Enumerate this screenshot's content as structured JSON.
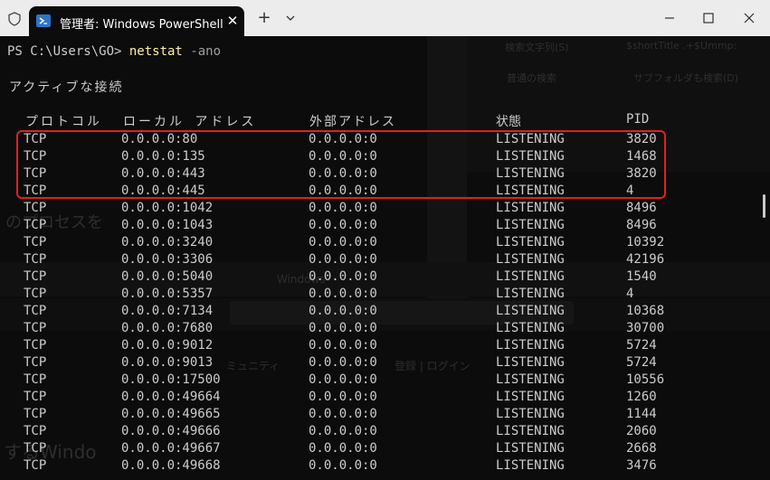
{
  "window": {
    "tab_title": "管理者: Windows PowerShell",
    "colors": {
      "titlebar": "#ececec",
      "terminal_bg": "#0c0c0c",
      "text": "#cccccc",
      "command": "#f9f1a5",
      "highlight": "#e02020"
    }
  },
  "terminal": {
    "prompt": "PS C:\\Users\\GO> ",
    "command": "netstat",
    "argument": " -ano",
    "heading": "アクティブな接続",
    "columns": [
      "プロトコル",
      "ローカル アドレス",
      "外部アドレス",
      "状態",
      "PID"
    ],
    "rows": [
      [
        "TCP",
        "0.0.0.0:80",
        "0.0.0.0:0",
        "LISTENING",
        "3820"
      ],
      [
        "TCP",
        "0.0.0.0:135",
        "0.0.0.0:0",
        "LISTENING",
        "1468"
      ],
      [
        "TCP",
        "0.0.0.0:443",
        "0.0.0.0:0",
        "LISTENING",
        "3820"
      ],
      [
        "TCP",
        "0.0.0.0:445",
        "0.0.0.0:0",
        "LISTENING",
        "4"
      ],
      [
        "TCP",
        "0.0.0.0:1042",
        "0.0.0.0:0",
        "LISTENING",
        "8496"
      ],
      [
        "TCP",
        "0.0.0.0:1043",
        "0.0.0.0:0",
        "LISTENING",
        "8496"
      ],
      [
        "TCP",
        "0.0.0.0:3240",
        "0.0.0.0:0",
        "LISTENING",
        "10392"
      ],
      [
        "TCP",
        "0.0.0.0:3306",
        "0.0.0.0:0",
        "LISTENING",
        "42196"
      ],
      [
        "TCP",
        "0.0.0.0:5040",
        "0.0.0.0:0",
        "LISTENING",
        "1540"
      ],
      [
        "TCP",
        "0.0.0.0:5357",
        "0.0.0.0:0",
        "LISTENING",
        "4"
      ],
      [
        "TCP",
        "0.0.0.0:7134",
        "0.0.0.0:0",
        "LISTENING",
        "10368"
      ],
      [
        "TCP",
        "0.0.0.0:7680",
        "0.0.0.0:0",
        "LISTENING",
        "30700"
      ],
      [
        "TCP",
        "0.0.0.0:9012",
        "0.0.0.0:0",
        "LISTENING",
        "5724"
      ],
      [
        "TCP",
        "0.0.0.0:9013",
        "0.0.0.0:0",
        "LISTENING",
        "5724"
      ],
      [
        "TCP",
        "0.0.0.0:17500",
        "0.0.0.0:0",
        "LISTENING",
        "10556"
      ],
      [
        "TCP",
        "0.0.0.0:49664",
        "0.0.0.0:0",
        "LISTENING",
        "1260"
      ],
      [
        "TCP",
        "0.0.0.0:49665",
        "0.0.0.0:0",
        "LISTENING",
        "1144"
      ],
      [
        "TCP",
        "0.0.0.0:49666",
        "0.0.0.0:0",
        "LISTENING",
        "2060"
      ],
      [
        "TCP",
        "0.0.0.0:49667",
        "0.0.0.0:0",
        "LISTENING",
        "2668"
      ],
      [
        "TCP",
        "0.0.0.0:49668",
        "0.0.0.0:0",
        "LISTENING",
        "3476"
      ]
    ]
  },
  "background_ghost": {
    "search_label": "検索文字列(S)",
    "search_value": "$shortTitle .+$Ummp:",
    "search_mode": "普通の検索",
    "subfolder_label": "サブフォルダも検索(D)",
    "process_text": "のプロセスを",
    "windows_text": "Windows",
    "community_text": "ミュニティ",
    "login_text": "登録 | ログイン",
    "bottom_text": "するWindo"
  }
}
